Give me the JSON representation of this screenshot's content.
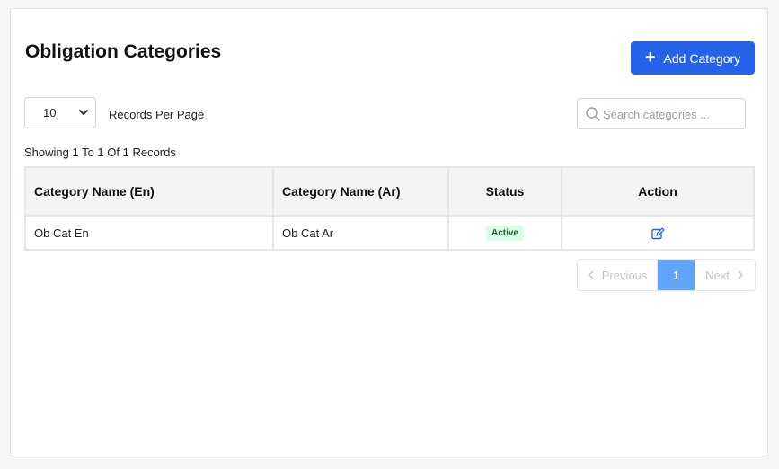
{
  "page": {
    "title": "Obligation Categories",
    "add_button_label": "Add Category"
  },
  "controls": {
    "records_per_page_value": "10",
    "records_per_page_label": "Records Per Page",
    "search_placeholder": "Search categories ..."
  },
  "summary": "Showing 1 To 1 Of 1 Records",
  "table": {
    "columns": [
      "Category Name (En)",
      "Category Name (Ar)",
      "Status",
      "Action"
    ],
    "rows": [
      {
        "name_en": "Ob Cat En",
        "name_ar": "Ob Cat Ar",
        "status": "Active"
      }
    ]
  },
  "pagination": {
    "previous_label": "Previous",
    "current_page": "1",
    "next_label": "Next"
  },
  "colors": {
    "primary": "#2563eb",
    "active_page": "#60a5fa",
    "status_active_bg": "#dcfce7",
    "status_active_text": "#166534"
  },
  "icons": [
    "plus-icon",
    "chevron-down-icon",
    "search-icon",
    "edit-icon",
    "chevron-left-icon",
    "chevron-right-icon"
  ]
}
